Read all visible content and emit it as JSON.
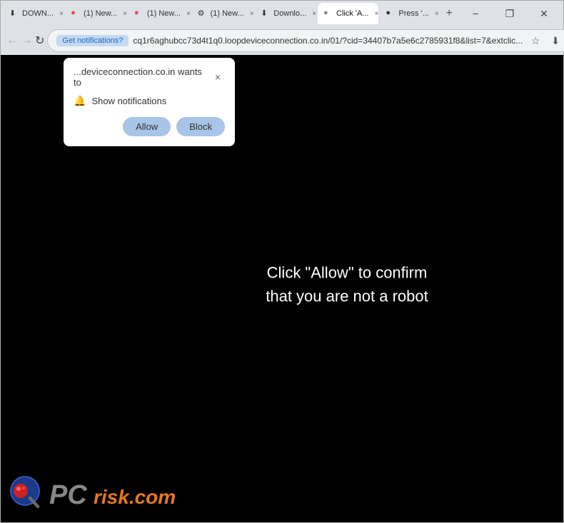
{
  "browser": {
    "tabs": [
      {
        "id": "tab1",
        "label": "DOWN...",
        "active": false,
        "icon": "⬇"
      },
      {
        "id": "tab2",
        "label": "(1) New...",
        "active": false,
        "icon": "●"
      },
      {
        "id": "tab3",
        "label": "(1) New...",
        "active": false,
        "icon": "●"
      },
      {
        "id": "tab4",
        "label": "(1) New...",
        "active": false,
        "icon": "⚙"
      },
      {
        "id": "tab5",
        "label": "Downlo...",
        "active": false,
        "icon": "⬇"
      },
      {
        "id": "tab6",
        "label": "Click 'A...",
        "active": true,
        "icon": "●"
      },
      {
        "id": "tab7",
        "label": "Press '...",
        "active": false,
        "icon": "●"
      }
    ],
    "window_controls": {
      "minimize": "−",
      "restore": "❐",
      "close": "✕"
    }
  },
  "nav": {
    "back_disabled": true,
    "forward_disabled": true,
    "notifications_btn": "Get notifications?",
    "address": "cq1r6aghubcc73d4t1q0.loopdeviceconnection.co.in/01/?cid=34407b7a5e6c2785931f8&list=7&extclic...",
    "new_tab_label": "+"
  },
  "notification_popup": {
    "title": "...deviceconnection.co.in wants to",
    "close_label": "×",
    "show_notifications_label": "Show notifications",
    "allow_button": "Allow",
    "block_button": "Block"
  },
  "page": {
    "main_text_line1": "Click \"Allow\" to confirm",
    "main_text_line2": "that you are not a robot",
    "background_color": "#000000"
  },
  "watermark": {
    "site": "pcrisk.com"
  }
}
